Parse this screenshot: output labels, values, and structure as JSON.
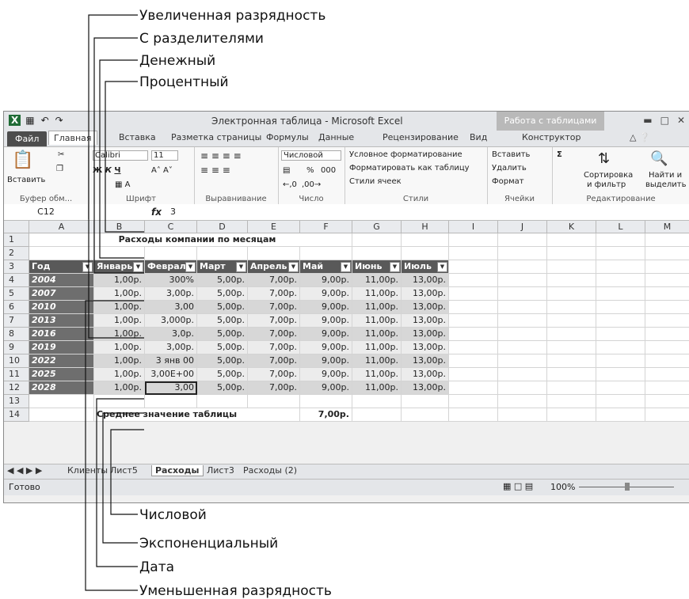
{
  "callouts_top": [
    "Увеличенная разрядность",
    "С разделителями",
    "Денежный",
    "Процентный"
  ],
  "callouts_bottom": [
    "Числовой",
    "Экспоненциальный",
    "Дата",
    "Уменьшенная разрядность"
  ],
  "window": {
    "title": "Электронная таблица  -  Microsoft Excel",
    "context_group": "Работа с таблицами"
  },
  "tabs": [
    "Файл",
    "Главная",
    "Вставка",
    "Разметка страницы",
    "Формулы",
    "Данные",
    "Рецензирование",
    "Вид",
    "Конструктор"
  ],
  "ribbon": {
    "clipboard": {
      "paste": "Вставить",
      "label": "Буфер обм..."
    },
    "font": {
      "name": "Calibri",
      "size": "11",
      "label": "Шрифт"
    },
    "alignment": {
      "label": "Выравнивание"
    },
    "number": {
      "format": "Числовой",
      "percent": "%",
      "thousands": "000",
      "label": "Число"
    },
    "styles": {
      "conditional": "Условное форматирование",
      "as_table": "Форматировать как таблицу",
      "cell_styles": "Стили ячеек",
      "label": "Стили"
    },
    "cells": {
      "insert": "Вставить",
      "delete": "Удалить",
      "format": "Формат",
      "label": "Ячейки"
    },
    "editing": {
      "sort1": "Сортировка",
      "sort2": "и фильтр",
      "find1": "Найти и",
      "find2": "выделить",
      "label": "Редактирование"
    }
  },
  "formula_bar": {
    "name_box": "C12",
    "fx": "fx",
    "value": "3"
  },
  "columns": [
    "A",
    "B",
    "C",
    "D",
    "E",
    "F",
    "G",
    "H",
    "I",
    "J",
    "K",
    "L",
    "M"
  ],
  "row_numbers": [
    "1",
    "2",
    "3",
    "4",
    "5",
    "6",
    "7",
    "8",
    "9",
    "10",
    "11",
    "12",
    "13",
    "14"
  ],
  "sheet": {
    "title": "Расходы компании по месяцам",
    "headers": [
      "Год",
      "Январь",
      "Февраль",
      "Март",
      "Апрель",
      "Май",
      "Июнь",
      "Июль"
    ],
    "rows": [
      [
        "2004",
        "1,00р.",
        "300%",
        "5,00р.",
        "7,00р.",
        "9,00р.",
        "11,00р.",
        "13,00р."
      ],
      [
        "2007",
        "1,00р.",
        "3,00р.",
        "5,00р.",
        "7,00р.",
        "9,00р.",
        "11,00р.",
        "13,00р."
      ],
      [
        "2010",
        "1,00р.",
        "3,00",
        "5,00р.",
        "7,00р.",
        "9,00р.",
        "11,00р.",
        "13,00р."
      ],
      [
        "2013",
        "1,00р.",
        "3,000р.",
        "5,00р.",
        "7,00р.",
        "9,00р.",
        "11,00р.",
        "13,00р."
      ],
      [
        "2016",
        "1,00р.",
        "3,0р.",
        "5,00р.",
        "7,00р.",
        "9,00р.",
        "11,00р.",
        "13,00р."
      ],
      [
        "2019",
        "1,00р.",
        "3,00р.",
        "5,00р.",
        "7,00р.",
        "9,00р.",
        "11,00р.",
        "13,00р."
      ],
      [
        "2022",
        "1,00р.",
        "3 янв 00",
        "5,00р.",
        "7,00р.",
        "9,00р.",
        "11,00р.",
        "13,00р."
      ],
      [
        "2025",
        "1,00р.",
        "3,00E+00",
        "5,00р.",
        "7,00р.",
        "9,00р.",
        "11,00р.",
        "13,00р."
      ],
      [
        "2028",
        "1,00р.",
        "3,00",
        "5,00р.",
        "7,00р.",
        "9,00р.",
        "11,00р.",
        "13,00р."
      ]
    ],
    "average_label": "Среднее значение таблицы",
    "average_value": "7,00р."
  },
  "sheet_tabs": [
    "Клиенты",
    "Лист5",
    "Расходы",
    "Лист3",
    "Расходы (2)"
  ],
  "active_sheet_tab": "Расходы",
  "status": {
    "ready": "Готово",
    "zoom": "100%"
  }
}
